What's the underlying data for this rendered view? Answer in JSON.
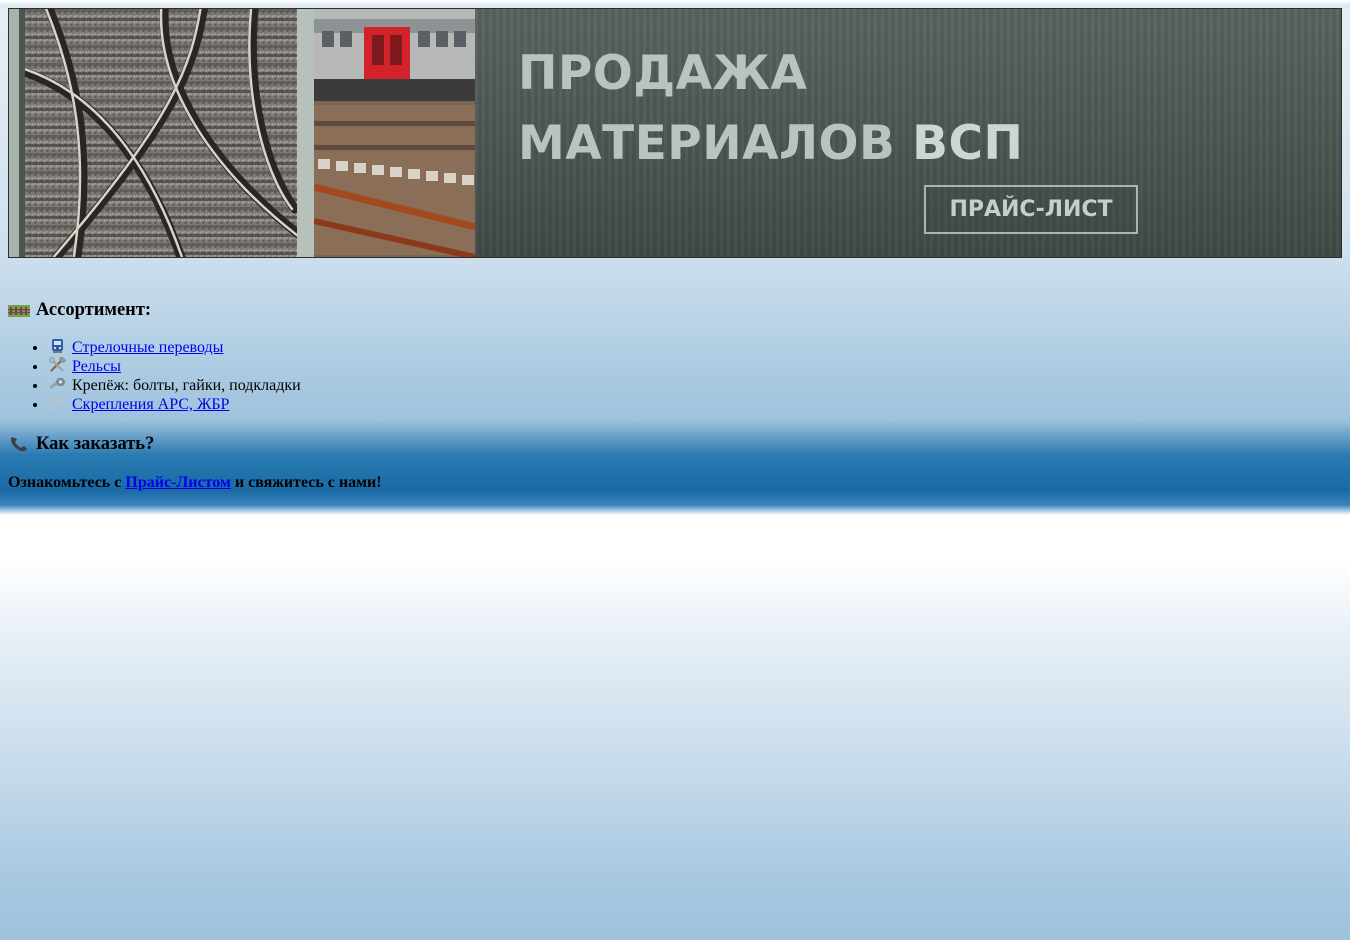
{
  "banner": {
    "title_line1": "ПРОДАЖА",
    "title_line2_light": "МАТЕРИАЛОВ",
    "title_line2_strong": "ВСП",
    "button_label": "ПРАЙС-ЛИСТ"
  },
  "assortment": {
    "heading": "Ассортимент:",
    "heading_icon": "railway-track-icon",
    "items": [
      {
        "label": "Стрелочные переводы",
        "icon": "tram-icon",
        "is_link": true
      },
      {
        "label": "Рельсы",
        "icon": "hammer-wrench-icon",
        "is_link": true
      },
      {
        "label": "Крепёж: болты, гайки, подкладки",
        "icon": "nut-bolt-icon",
        "is_link": false
      },
      {
        "label": "Скрепления АРС, ЖБР",
        "icon": "link-icon",
        "is_link": true
      }
    ]
  },
  "order": {
    "heading": "Как заказать?",
    "heading_icon": "telephone-icon",
    "text_before": "Ознакомьтесь с",
    "link_text": "Прайс-Листом",
    "text_after": "и свяжитесь с нами!"
  },
  "colors": {
    "link": "#0000ee",
    "banner_text": "#b9c4bf",
    "banner_bg": "#4d5753"
  }
}
